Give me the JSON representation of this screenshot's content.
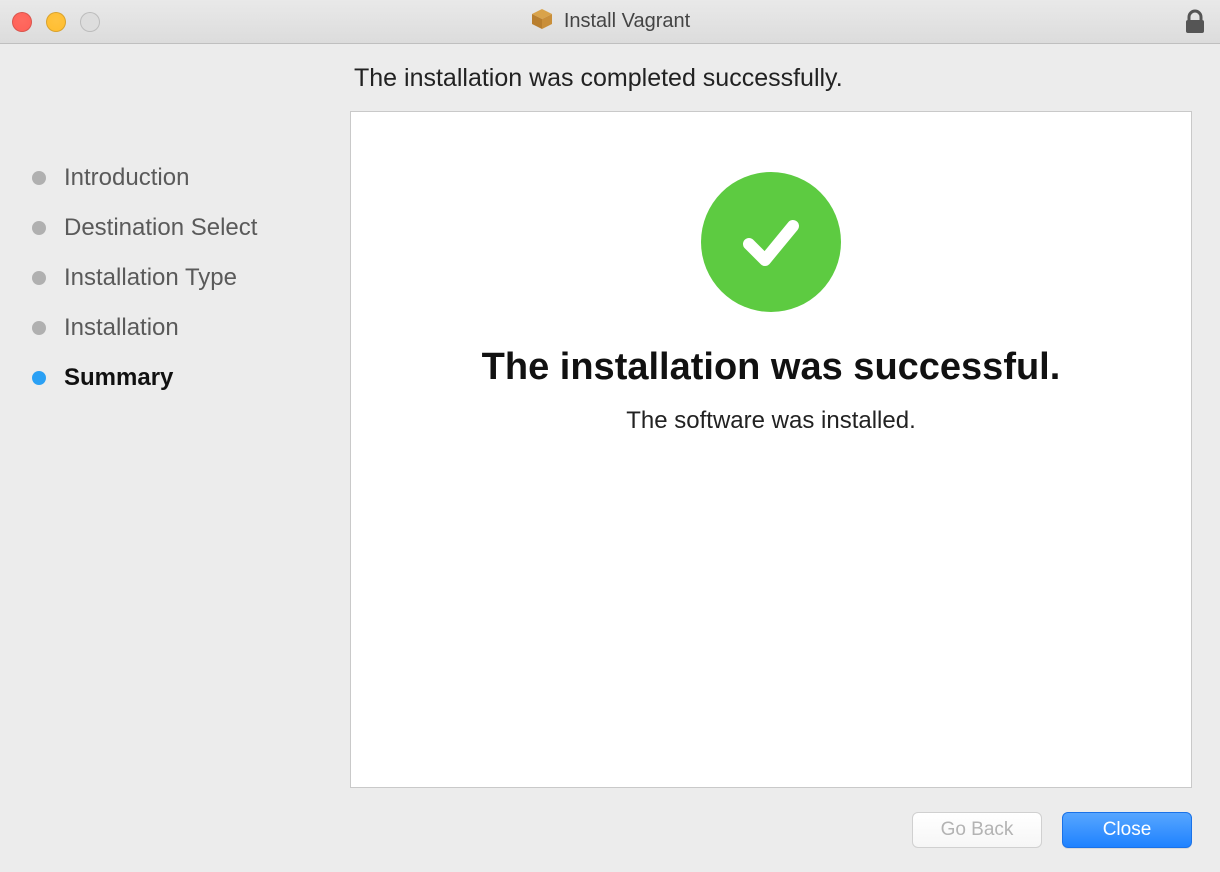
{
  "titlebar": {
    "title": "Install Vagrant"
  },
  "header": {
    "message": "The installation was completed successfully."
  },
  "sidebar": {
    "steps": [
      {
        "label": "Introduction",
        "active": false
      },
      {
        "label": "Destination Select",
        "active": false
      },
      {
        "label": "Installation Type",
        "active": false
      },
      {
        "label": "Installation",
        "active": false
      },
      {
        "label": "Summary",
        "active": true
      }
    ]
  },
  "panel": {
    "headline": "The installation was successful.",
    "subline": "The software was installed."
  },
  "footer": {
    "go_back": "Go Back",
    "close": "Close"
  }
}
